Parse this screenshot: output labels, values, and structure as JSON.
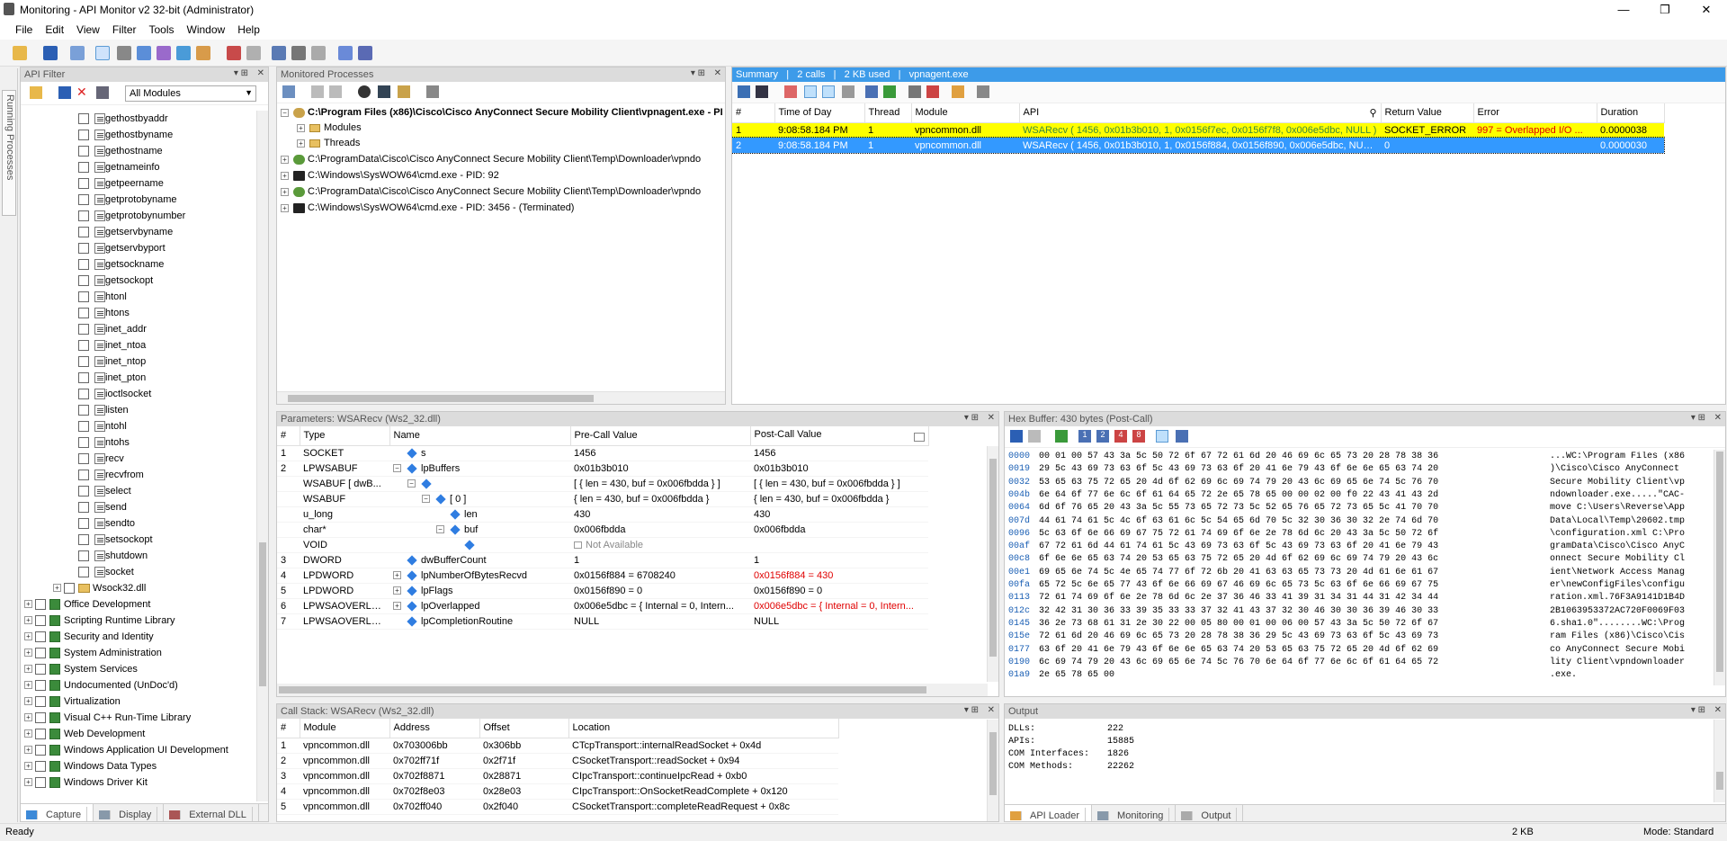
{
  "window": {
    "title": "Monitoring - API Monitor v2 32-bit (Administrator)"
  },
  "menu": [
    "File",
    "Edit",
    "View",
    "Filter",
    "Tools",
    "Window",
    "Help"
  ],
  "side_tab": "Running Processes",
  "api_filter": {
    "title": "API Filter",
    "module_select": "All Modules",
    "functions": [
      "gethostbyaddr",
      "gethostbyname",
      "gethostname",
      "getnameinfo",
      "getpeername",
      "getprotobyname",
      "getprotobynumber",
      "getservbyname",
      "getservbyport",
      "getsockname",
      "getsockopt",
      "htonl",
      "htons",
      "inet_addr",
      "inet_ntoa",
      "inet_ntop",
      "inet_pton",
      "ioctlsocket",
      "listen",
      "ntohl",
      "ntohs",
      "recv",
      "recvfrom",
      "select",
      "send",
      "sendto",
      "setsockopt",
      "shutdown",
      "socket"
    ],
    "dll_node": "Wsock32.dll",
    "categories": [
      "Office Development",
      "Scripting Runtime Library",
      "Security and Identity",
      "System Administration",
      "System Services",
      "Undocumented (UnDoc'd)",
      "Virtualization",
      "Visual C++ Run-Time Library",
      "Web Development",
      "Windows Application UI Development",
      "Windows Data Types",
      "Windows Driver Kit"
    ],
    "tabs": [
      "Capture",
      "Display",
      "External DLL"
    ]
  },
  "processes": {
    "title": "Monitored Processes",
    "items": [
      {
        "label": "C:\\Program Files (x86)\\Cisco\\Cisco AnyConnect Secure Mobility Client\\vpnagent.exe - PI",
        "bold": true
      },
      {
        "label": "Modules",
        "child": true
      },
      {
        "label": "Threads",
        "child": true
      },
      {
        "label": "C:\\ProgramData\\Cisco\\Cisco AnyConnect Secure Mobility Client\\Temp\\Downloader\\vpndo"
      },
      {
        "label": "C:\\Windows\\SysWOW64\\cmd.exe - PID: 92"
      },
      {
        "label": "C:\\ProgramData\\Cisco\\Cisco AnyConnect Secure Mobility Client\\Temp\\Downloader\\vpndo"
      },
      {
        "label": "C:\\Windows\\SysWOW64\\cmd.exe - PID: 3456 - (Terminated)"
      }
    ]
  },
  "summary": {
    "title_parts": [
      "Summary",
      "|",
      "2 calls",
      "|",
      "2 KB used",
      "|",
      "vpnagent.exe"
    ],
    "columns": [
      "#",
      "Time of Day",
      "Thread",
      "Module",
      "API",
      "Return Value",
      "Error",
      "Duration"
    ],
    "rows": [
      {
        "n": "1",
        "time": "9:08:58.184 PM",
        "thread": "1",
        "module": "vpncommon.dll",
        "api": "WSARecv ( 1456, 0x01b3b010, 1, 0x0156f7ec, 0x0156f7f8, 0x006e5dbc, NULL )",
        "ret": "SOCKET_ERROR",
        "err": "997 = Overlapped I/O ...",
        "dur": "0.0000038"
      },
      {
        "n": "2",
        "time": "9:08:58.184 PM",
        "thread": "1",
        "module": "vpncommon.dll",
        "api": "WSARecv ( 1456, 0x01b3b010, 1, 0x0156f884, 0x0156f890, 0x006e5dbc, NULL )",
        "ret": "0",
        "err": "",
        "dur": "0.0000030"
      }
    ]
  },
  "params": {
    "title": "Parameters: WSARecv (Ws2_32.dll)",
    "columns": [
      "#",
      "Type",
      "Name",
      "Pre-Call Value",
      "Post-Call Value"
    ],
    "rows": [
      {
        "n": "1",
        "type": "SOCKET",
        "name": "s",
        "ind": 0,
        "exp": "",
        "pre": "1456",
        "post": "1456",
        "red": false
      },
      {
        "n": "2",
        "type": "LPWSABUF",
        "name": "lpBuffers",
        "ind": 0,
        "exp": "−",
        "pre": "0x01b3b010",
        "post": "0x01b3b010",
        "red": false
      },
      {
        "n": "",
        "type": "WSABUF [ dwB...",
        "name": "",
        "ind": 1,
        "exp": "−",
        "pre": "[ { len = 430, buf = 0x006fbdda } ]",
        "post": "[ { len = 430, buf = 0x006fbdda } ]",
        "red": false
      },
      {
        "n": "",
        "type": "WSABUF",
        "name": "[ 0 ]",
        "ind": 2,
        "exp": "−",
        "pre": "{ len = 430, buf = 0x006fbdda }",
        "post": "{ len = 430, buf = 0x006fbdda }",
        "red": false
      },
      {
        "n": "",
        "type": "u_long",
        "name": "len",
        "ind": 3,
        "exp": "",
        "pre": "430",
        "post": "430",
        "red": false
      },
      {
        "n": "",
        "type": "char*",
        "name": "buf",
        "ind": 3,
        "exp": "−",
        "pre": "0x006fbdda",
        "post": "0x006fbdda",
        "red": false
      },
      {
        "n": "",
        "type": "VOID",
        "name": "",
        "ind": 4,
        "exp": "",
        "pre": "Not Available",
        "post": "",
        "red": false
      },
      {
        "n": "3",
        "type": "DWORD",
        "name": "dwBufferCount",
        "ind": 0,
        "exp": "",
        "pre": "1",
        "post": "1",
        "red": false
      },
      {
        "n": "4",
        "type": "LPDWORD",
        "name": "lpNumberOfBytesRecvd",
        "ind": 0,
        "exp": "+",
        "pre": "0x0156f884 = 6708240",
        "post": "0x0156f884 = 430",
        "red": true
      },
      {
        "n": "5",
        "type": "LPDWORD",
        "name": "lpFlags",
        "ind": 0,
        "exp": "+",
        "pre": "0x0156f890 = 0",
        "post": "0x0156f890 = 0",
        "red": false
      },
      {
        "n": "6",
        "type": "LPWSAOVERLA...",
        "name": "lpOverlapped",
        "ind": 0,
        "exp": "+",
        "pre": "0x006e5dbc = { Internal = 0, Intern...",
        "post": "0x006e5dbc = { Internal = 0, Intern...",
        "red": true
      },
      {
        "n": "7",
        "type": "LPWSAOVERLA...",
        "name": "lpCompletionRoutine",
        "ind": 0,
        "exp": "",
        "pre": "NULL",
        "post": "NULL",
        "red": false
      }
    ]
  },
  "hex": {
    "title": "Hex Buffer: 430 bytes (Post-Call)",
    "rows": [
      {
        "off": "0000",
        "bytes": "00 01 00 57 43 3a 5c 50 72 6f 67 72 61 6d 20 46 69 6c 65 73 20 28 78 38 36",
        "ascii": "...WC:\\Program Files (x86"
      },
      {
        "off": "0019",
        "bytes": "29 5c 43 69 73 63 6f 5c 43 69 73 63 6f 20 41 6e 79 43 6f 6e 6e 65 63 74 20",
        "ascii": ")\\Cisco\\Cisco AnyConnect"
      },
      {
        "off": "0032",
        "bytes": "53 65 63 75 72 65 20 4d 6f 62 69 6c 69 74 79 20 43 6c 69 65 6e 74 5c 76 70",
        "ascii": "Secure Mobility Client\\vp"
      },
      {
        "off": "004b",
        "bytes": "6e 64 6f 77 6e 6c 6f 61 64 65 72 2e 65 78 65 00 00 02 00 f0 22 43 41 43 2d",
        "ascii": "ndownloader.exe.....\"CAC-"
      },
      {
        "off": "0064",
        "bytes": "6d 6f 76 65 20 43 3a 5c 55 73 65 72 73 5c 52 65 76 65 72 73 65 5c 41 70 70",
        "ascii": "move C:\\Users\\Reverse\\App"
      },
      {
        "off": "007d",
        "bytes": "44 61 74 61 5c 4c 6f 63 61 6c 5c 54 65 6d 70 5c 32 30 36 30 32 2e 74 6d 70",
        "ascii": "Data\\Local\\Temp\\20602.tmp"
      },
      {
        "off": "0096",
        "bytes": "5c 63 6f 6e 66 69 67 75 72 61 74 69 6f 6e 2e 78 6d 6c 20 43 3a 5c 50 72 6f",
        "ascii": "\\configuration.xml C:\\Pro"
      },
      {
        "off": "00af",
        "bytes": "67 72 61 6d 44 61 74 61 5c 43 69 73 63 6f 5c 43 69 73 63 6f 20 41 6e 79 43",
        "ascii": "gramData\\Cisco\\Cisco AnyC"
      },
      {
        "off": "00c8",
        "bytes": "6f 6e 6e 65 63 74 20 53 65 63 75 72 65 20 4d 6f 62 69 6c 69 74 79 20 43 6c",
        "ascii": "onnect Secure Mobility Cl"
      },
      {
        "off": "00e1",
        "bytes": "69 65 6e 74 5c 4e 65 74 77 6f 72 6b 20 41 63 63 65 73 73 20 4d 61 6e 61 67",
        "ascii": "ient\\Network Access Manag"
      },
      {
        "off": "00fa",
        "bytes": "65 72 5c 6e 65 77 43 6f 6e 66 69 67 46 69 6c 65 73 5c 63 6f 6e 66 69 67 75",
        "ascii": "er\\newConfigFiles\\configu"
      },
      {
        "off": "0113",
        "bytes": "72 61 74 69 6f 6e 2e 78 6d 6c 2e 37 36 46 33 41 39 31 34 31 44 31 42 34 44",
        "ascii": "ration.xml.76F3A9141D1B4D"
      },
      {
        "off": "012c",
        "bytes": "32 42 31 30 36 33 39 35 33 33 37 32 41 43 37 32 30 46 30 30 36 39 46 30 33",
        "ascii": "2B1063953372AC720F0069F03"
      },
      {
        "off": "0145",
        "bytes": "36 2e 73 68 61 31 2e 30 22 00 05 80 00 01 00 06 00 57 43 3a 5c 50 72 6f 67",
        "ascii": "6.sha1.0\"........WC:\\Prog"
      },
      {
        "off": "015e",
        "bytes": "72 61 6d 20 46 69 6c 65 73 20 28 78 38 36 29 5c 43 69 73 63 6f 5c 43 69 73",
        "ascii": "ram Files (x86)\\Cisco\\Cis"
      },
      {
        "off": "0177",
        "bytes": "63 6f 20 41 6e 79 43 6f 6e 6e 65 63 74 20 53 65 63 75 72 65 20 4d 6f 62 69",
        "ascii": "co AnyConnect Secure Mobi"
      },
      {
        "off": "0190",
        "bytes": "6c 69 74 79 20 43 6c 69 65 6e 74 5c 76 70 6e 64 6f 77 6e 6c 6f 61 64 65 72",
        "ascii": "lity Client\\vpndownloader"
      },
      {
        "off": "01a9",
        "bytes": "2e 65 78 65 00",
        "ascii": ".exe."
      }
    ]
  },
  "callstack": {
    "title": "Call Stack: WSARecv (Ws2_32.dll)",
    "columns": [
      "#",
      "Module",
      "Address",
      "Offset",
      "Location"
    ],
    "rows": [
      {
        "n": "1",
        "module": "vpncommon.dll",
        "addr": "0x703006bb",
        "off": "0x306bb",
        "loc": "CTcpTransport::internalReadSocket + 0x4d"
      },
      {
        "n": "2",
        "module": "vpncommon.dll",
        "addr": "0x702ff71f",
        "off": "0x2f71f",
        "loc": "CSocketTransport::readSocket + 0x94"
      },
      {
        "n": "3",
        "module": "vpncommon.dll",
        "addr": "0x702f8871",
        "off": "0x28871",
        "loc": "CIpcTransport::continueIpcRead + 0xb0"
      },
      {
        "n": "4",
        "module": "vpncommon.dll",
        "addr": "0x702f8e03",
        "off": "0x28e03",
        "loc": "CIpcTransport::OnSocketReadComplete + 0x120"
      },
      {
        "n": "5",
        "module": "vpncommon.dll",
        "addr": "0x702ff040",
        "off": "0x2f040",
        "loc": "CSocketTransport::completeReadRequest + 0x8c"
      }
    ]
  },
  "output": {
    "title": "Output",
    "lines": [
      {
        "k": "DLLs:",
        "v": "222"
      },
      {
        "k": "APIs:",
        "v": "15885"
      },
      {
        "k": "COM Interfaces:",
        "v": "1826"
      },
      {
        "k": "COM Methods:",
        "v": "22262"
      }
    ],
    "tabs": [
      "API Loader",
      "Monitoring",
      "Output"
    ]
  },
  "status": {
    "left": "Ready",
    "size": "2 KB",
    "mode": "Mode: Standard"
  },
  "colors": {
    "highlight_yellow": "#ffff00",
    "selection_blue": "#3399ff",
    "header_blue": "#3d9be9",
    "error_red": "#e00000"
  }
}
